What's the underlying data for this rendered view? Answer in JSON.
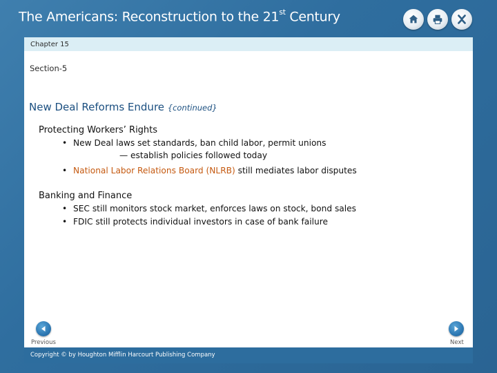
{
  "header": {
    "title_main": "The Americans: Reconstruction to the 21",
    "title_sup": "st",
    "title_end": " Century"
  },
  "nav_icons": [
    "home-icon",
    "print-icon",
    "close-icon"
  ],
  "chapter": "Chapter 15",
  "section": "Section-5",
  "heading": {
    "title": "New Deal Reforms Endure ",
    "suffix": "{continued}"
  },
  "groups": [
    {
      "title": "Protecting Workers’ Rights",
      "bullets": [
        "New Deal laws set standards, ban child labor, permit unions",
        "— establish policies followed today"
      ],
      "bullet2_highlight": "National Labor Relations Board (NLRB)",
      "bullet2_rest": " still mediates labor disputes"
    },
    {
      "title": "Banking and Finance",
      "bullets": [
        "SEC still monitors stock market, enforces laws on stock, bond sales",
        "FDIC still protects individual investors in case of bank failure"
      ]
    }
  ],
  "nav": {
    "previous": "Previous",
    "next": "Next"
  },
  "footer": {
    "copyright": "Copyright © by Houghton Mifflin Harcourt Publishing Company"
  },
  "colors": {
    "background": "#2f6e9f",
    "heading": "#1b4f80",
    "highlight": "#c55a11",
    "chapter_bar": "#dbeef5"
  }
}
